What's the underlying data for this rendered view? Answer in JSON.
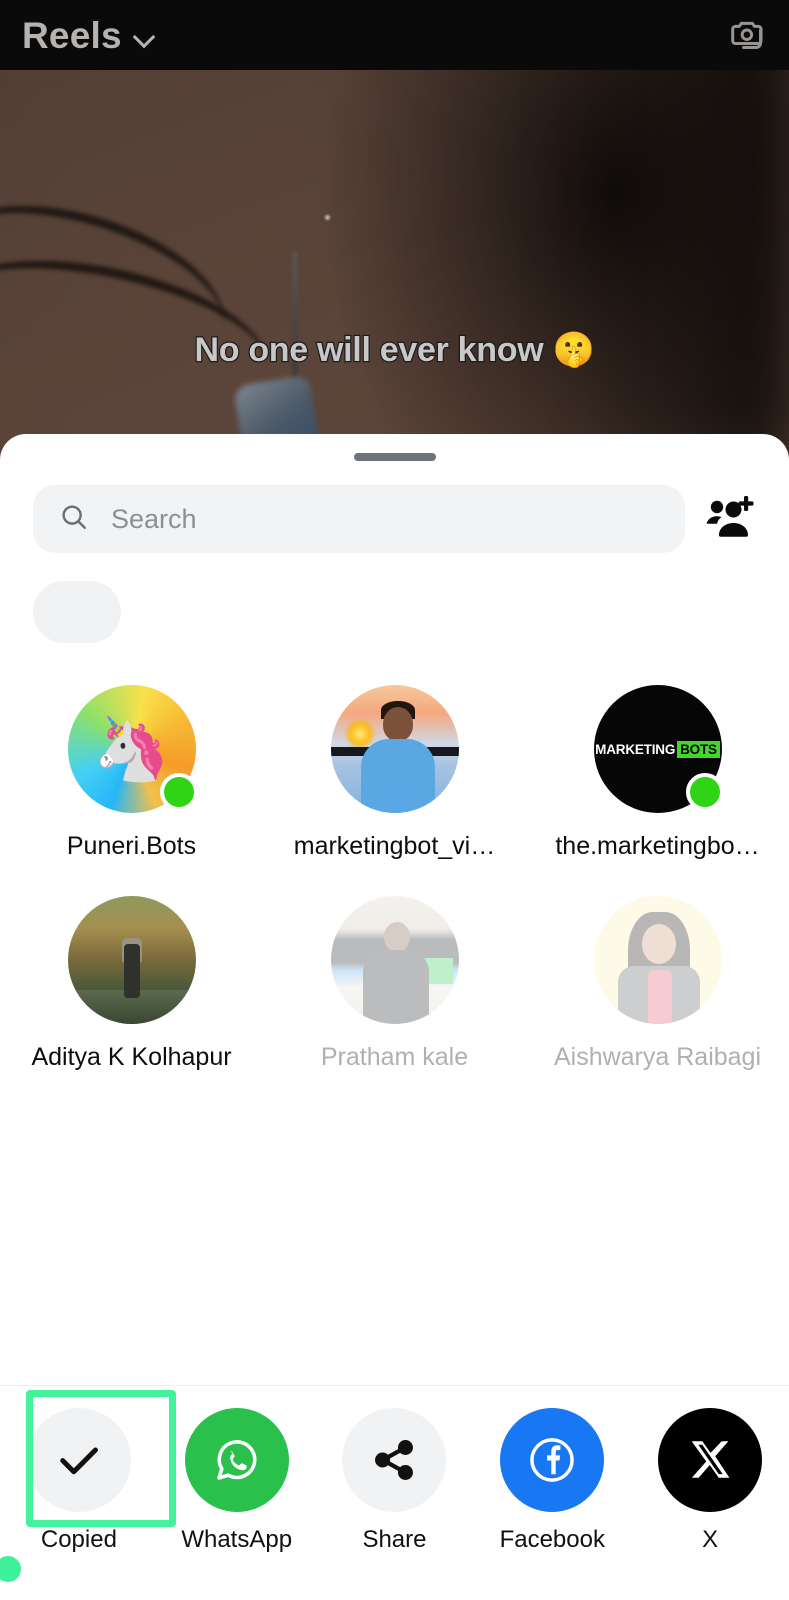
{
  "app": {
    "header": {
      "title": "Reels",
      "chevron_icon": "chevron-down-icon",
      "camera_icon": "camera-icon"
    },
    "video": {
      "caption": "No one will ever know 🤫"
    }
  },
  "share_sheet": {
    "drag_handle": "drag-handle",
    "search": {
      "placeholder": "Search",
      "value": "",
      "search_icon": "search-icon"
    },
    "add_people_icon": "add-people-icon",
    "people": [
      {
        "name": "Puneri.Bots",
        "avatar_type": "unicorn-gradient",
        "avatar_glyph": "🦄",
        "online": true,
        "faded": false
      },
      {
        "name": "marketingbot_vi…",
        "avatar_type": "photo-portrait-sunset",
        "online": false,
        "faded": false
      },
      {
        "name": "the.marketingbo…",
        "avatar_type": "logo-marketing-bots",
        "logo_part_1": "MARKETING",
        "logo_part_2": "BOTS",
        "online": true,
        "faded": false
      },
      {
        "name": "Aditya K Kolhapur",
        "avatar_type": "photo-nature",
        "online": false,
        "faded": false
      },
      {
        "name": "Pratham kale",
        "avatar_type": "photo-stage",
        "online": false,
        "faded": true
      },
      {
        "name": "Aishwarya Raibagi",
        "avatar_type": "photo-yellow-bg",
        "online": false,
        "faded": true
      }
    ],
    "share_targets": [
      {
        "label": "Copied",
        "icon": "checkmark-icon",
        "style": "grey",
        "highlighted": true
      },
      {
        "label": "WhatsApp",
        "icon": "whatsapp-icon",
        "style": "whatsapp",
        "highlighted": false
      },
      {
        "label": "Share",
        "icon": "share-nodes-icon",
        "style": "grey",
        "highlighted": false
      },
      {
        "label": "Facebook",
        "icon": "facebook-icon",
        "style": "facebook",
        "highlighted": false
      },
      {
        "label": "X",
        "icon": "x-twitter-icon",
        "style": "x",
        "highlighted": false
      }
    ]
  },
  "colors": {
    "highlight_green": "#44f29b",
    "whatsapp_green": "#29c04b",
    "facebook_blue": "#1877f2",
    "online_dot_green": "#2fd415",
    "sheet_background": "#ffffff",
    "search_background": "#f2f3f5"
  }
}
